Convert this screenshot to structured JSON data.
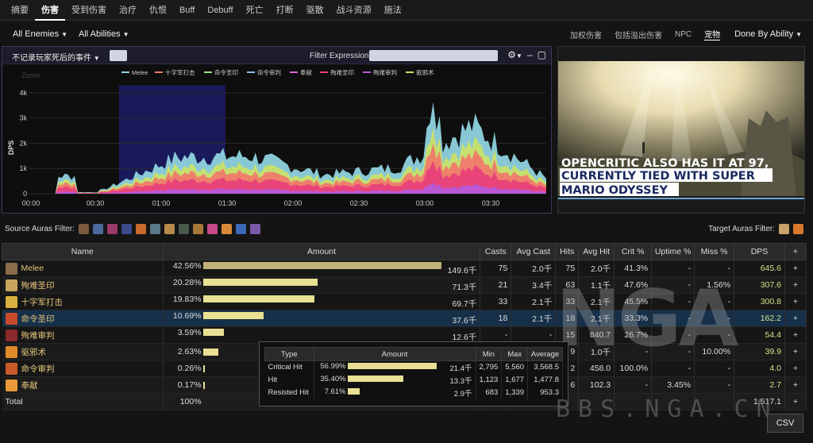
{
  "tabs": [
    "摘要",
    "伤害",
    "受到伤害",
    "治疗",
    "仇恨",
    "Buff",
    "Debuff",
    "死亡",
    "打断",
    "驱散",
    "战斗资源",
    "施法"
  ],
  "active_tab_index": 1,
  "filters": {
    "enemies": "All Enemies",
    "abilities": "All Abilities"
  },
  "view_options": [
    "加权伤害",
    "包括溢出伤害",
    "NPC",
    "宠物"
  ],
  "selected_view_option": "宠物",
  "done_by": "Done By Ability",
  "graph": {
    "header_left": "不记录玩家死后的事件",
    "filter_label": "Filter Expression:",
    "zoom_label": "Zoom",
    "ylabel": "DPS",
    "legend": [
      {
        "name": "Melee",
        "color": "#8fd3e0"
      },
      {
        "name": "十字军打击",
        "color": "#f07a6a"
      },
      {
        "name": "命令圣印",
        "color": "#9ee07a"
      },
      {
        "name": "命令审判",
        "color": "#8fb8e8"
      },
      {
        "name": "奉献",
        "color": "#d86ad8"
      },
      {
        "name": "殉难圣印",
        "color": "#e8407a"
      },
      {
        "name": "殉难审判",
        "color": "#b85ad8"
      },
      {
        "name": "驱邪术",
        "color": "#c8e06a"
      }
    ],
    "yticks": [
      "0",
      "1k",
      "2k",
      "3k",
      "4k"
    ],
    "xticks": [
      "00:00",
      "00:30",
      "01:00",
      "01:30",
      "02:00",
      "02:30",
      "03:00",
      "03:30"
    ]
  },
  "chart_data": {
    "type": "area",
    "ylabel": "DPS",
    "ylim": [
      0,
      4500
    ],
    "x": [
      "00:00",
      "00:30",
      "01:00",
      "01:30",
      "02:00",
      "02:30",
      "03:00",
      "03:30"
    ],
    "series": [
      {
        "name": "Melee",
        "values": [
          0,
          150,
          1450,
          1500,
          750,
          1050,
          2700,
          600
        ]
      },
      {
        "name": "殉难圣印",
        "values": [
          0,
          100,
          650,
          600,
          350,
          500,
          1100,
          300
        ]
      }
    ],
    "zoom_selection": [
      "00:13",
      "01:33"
    ]
  },
  "video": {
    "line1": "OPENCRITIC ALSO HAS IT AT 97,",
    "line2": "CURRENTLY TIED WITH SUPER",
    "line3": "MARIO ODYSSEY"
  },
  "source_auras_label": "Source Auras Filter:",
  "target_auras_label": "Target Auras Filter:",
  "table": {
    "headers": [
      "Name",
      "Amount",
      "Casts",
      "Avg Cast",
      "Hits",
      "Avg Hit",
      "Crit %",
      "Uptime %",
      "Miss %",
      "DPS",
      "+"
    ],
    "rows": [
      {
        "name": "Melee",
        "pct": "42.56%",
        "frac": 1.0,
        "amount": "149.6千",
        "casts": "75",
        "avgcast": "2.0千",
        "hits": "75",
        "avghit": "2.0千",
        "crit": "41.3%",
        "uptime": "-",
        "miss": "-",
        "dps": "645.6",
        "icon": "#8a6b4a"
      },
      {
        "name": "殉难圣印",
        "pct": "20.28%",
        "frac": 0.48,
        "amount": "71.3千",
        "casts": "21",
        "avgcast": "3.4千",
        "hits": "63",
        "avghit": "1.1千",
        "crit": "47.6%",
        "uptime": "-",
        "miss": "1.56%",
        "dps": "307.6",
        "icon": "#c9a45a"
      },
      {
        "name": "十字军打击",
        "pct": "19.83%",
        "frac": 0.466,
        "amount": "69.7千",
        "casts": "33",
        "avgcast": "2.1千",
        "hits": "33",
        "avghit": "2.1千",
        "crit": "45.5%",
        "uptime": "-",
        "miss": "-",
        "dps": "300.8",
        "icon": "#d8b040"
      },
      {
        "name": "命令圣印",
        "pct": "10.69%",
        "frac": 0.251,
        "amount": "37.6千",
        "casts": "18",
        "avgcast": "2.1千",
        "hits": "18",
        "avghit": "2.1千",
        "crit": "33.3%",
        "uptime": "-",
        "miss": "-",
        "dps": "162.2",
        "icon": "#c84a2a"
      },
      {
        "name": "殉难审判",
        "pct": "3.59%",
        "frac": 0.084,
        "amount": "12.6千",
        "casts": "-",
        "avgcast": "-",
        "hits": "15",
        "avghit": "840.7",
        "crit": "26.7%",
        "uptime": "-",
        "miss": "-",
        "dps": "54.4",
        "icon": "#8a2a2a"
      },
      {
        "name": "驱邪术",
        "pct": "2.63%",
        "frac": 0.062,
        "amount": "",
        "casts": "",
        "avgcast": "",
        "hits": "9",
        "avghit": "1.0千",
        "crit": "-",
        "uptime": "-",
        "miss": "10.00%",
        "dps": "39.9",
        "icon": "#e08a2a"
      },
      {
        "name": "命令审判",
        "pct": "0.26%",
        "frac": 0.006,
        "amount": "",
        "casts": "",
        "avgcast": "",
        "hits": "2",
        "avghit": "458.0",
        "crit": "100.0%",
        "uptime": "-",
        "miss": "-",
        "dps": "4.0",
        "icon": "#c85a2a"
      },
      {
        "name": "奉献",
        "pct": "0.17%",
        "frac": 0.004,
        "amount": "",
        "casts": "",
        "avgcast": "",
        "hits": "6",
        "avghit": "102.3",
        "crit": "-",
        "uptime": "3.45%",
        "miss": "-",
        "dps": "2.7",
        "icon": "#e89a3a"
      }
    ],
    "total": {
      "name": "Total",
      "pct": "100%",
      "dps": "1,517.1"
    }
  },
  "tooltip": {
    "headers": [
      "Type",
      "Amount",
      "Min",
      "Max",
      "Average"
    ],
    "rows": [
      {
        "type": "Critical Hit",
        "pct": "56.99%",
        "frac": 1.0,
        "amount": "21.4千",
        "min": "2,795",
        "max": "5,560",
        "avg": "3,568.5"
      },
      {
        "type": "Hit",
        "pct": "35.40%",
        "frac": 0.62,
        "amount": "13.3千",
        "min": "1,123",
        "max": "1,677",
        "avg": "1,477.8"
      },
      {
        "type": "Resisted Hit",
        "pct": "7.61%",
        "frac": 0.134,
        "amount": "2.9千",
        "min": "683",
        "max": "1,339",
        "avg": "953.3"
      }
    ]
  },
  "csv_label": "CSV",
  "watermark": "BBS.NGA.CN",
  "watermark_logo": "NGA"
}
